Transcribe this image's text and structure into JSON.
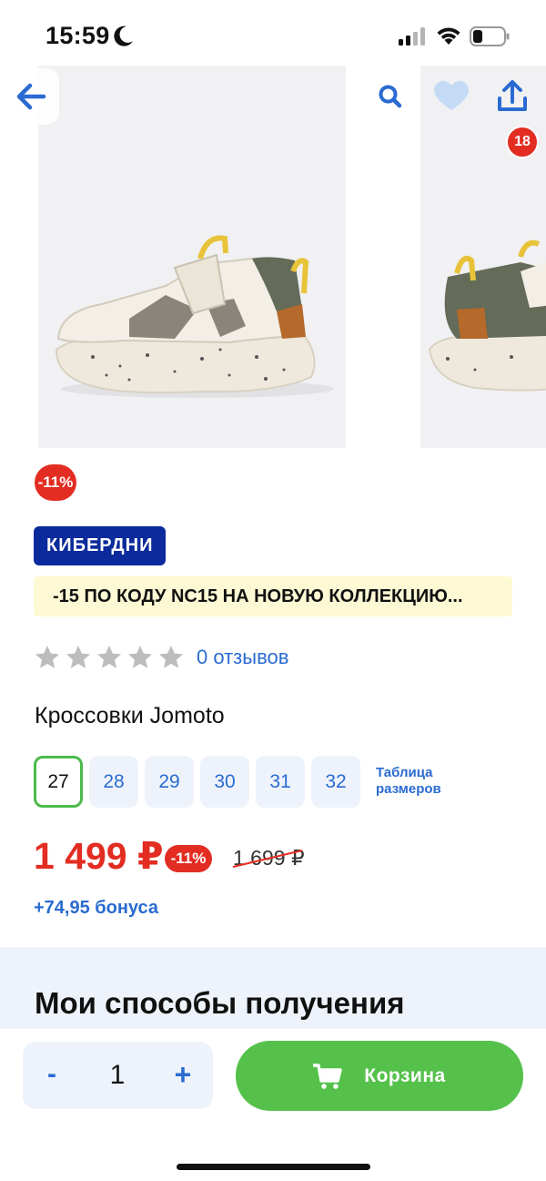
{
  "status_bar": {
    "time": "15:59"
  },
  "gallery": {
    "image_description": ""
  },
  "header": {
    "back_icon": "arrow-left-icon",
    "search_icon": "search-icon",
    "favorite_icon": "heart-icon",
    "share_icon": "share-icon"
  },
  "product": {
    "discount_badge": "-11%",
    "campaign_tag": "КИБЕРДНИ",
    "promo_text": "-15 ПО КОДУ NC15 НА НОВУЮ КОЛЛЕКЦИЮ...",
    "rating": {
      "stars_filled": 0,
      "stars_total": 5,
      "reviews_label": "0 отзывов"
    },
    "title": "Кроссовки Jomoto",
    "sizes": [
      "27",
      "28",
      "29",
      "30",
      "31",
      "32"
    ],
    "selected_size": "27",
    "size_table_line1": "Таблица",
    "size_table_line2": "размеров",
    "price": "1 499 ₽",
    "price_discount": "-11%",
    "old_price": "1 699 ₽",
    "bonus": "+74,95 бонуса"
  },
  "delivery": {
    "title": "Мои способы получения"
  },
  "bottom_bar": {
    "qty_minus": "-",
    "quantity": "1",
    "qty_plus": "+",
    "cart_label": "Корзина",
    "cart_count": "18"
  },
  "colors": {
    "accent_blue": "#2a6bd1",
    "sale_red": "#e32d22",
    "cart_green": "#55c14b",
    "campaign_navy": "#0b2a9c",
    "promo_bg": "#fdf9d4"
  }
}
